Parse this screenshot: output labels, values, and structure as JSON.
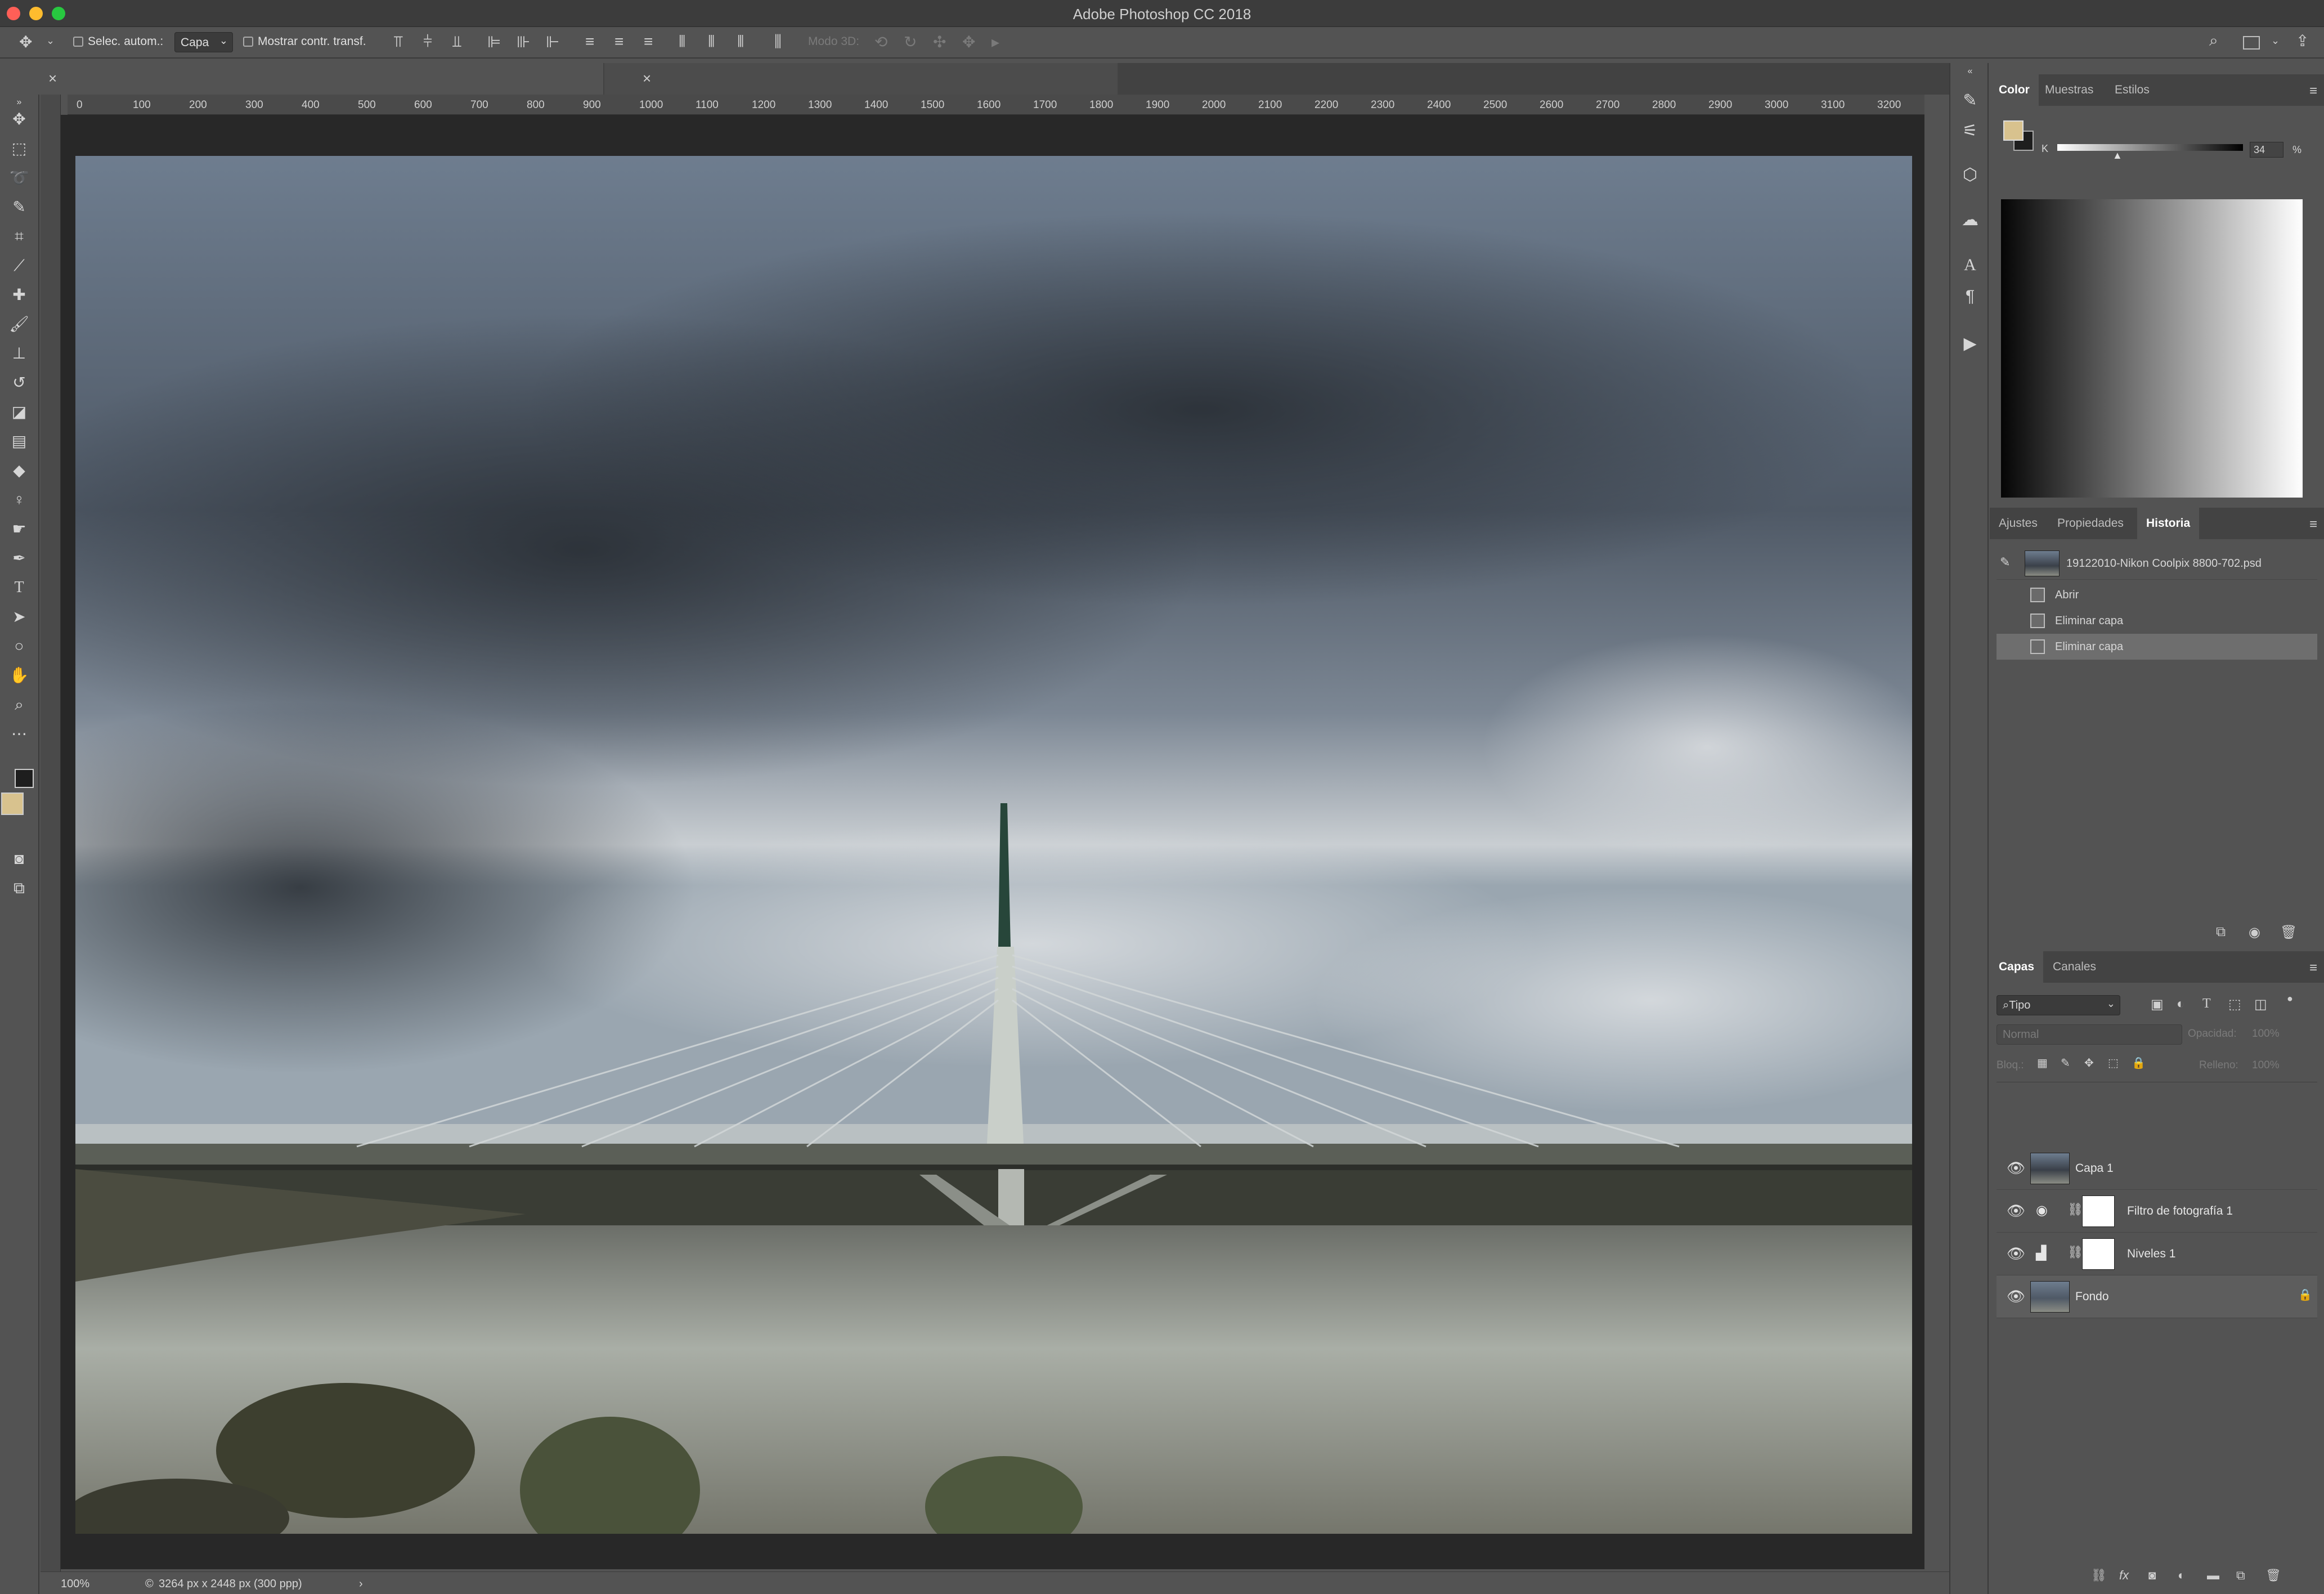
{
  "app": {
    "title": "Adobe Photoshop CC 2018"
  },
  "options": {
    "auto_select_label": "Selec. autom.:",
    "auto_select_value": "Capa",
    "show_transform_label": "Mostrar contr. transf.",
    "mode3d_label": "Modo 3D:"
  },
  "rulers": {
    "h_ticks": [
      "0",
      "100",
      "200",
      "300",
      "400",
      "500",
      "600",
      "700",
      "800",
      "900",
      "1000",
      "1100",
      "1200",
      "1300",
      "1400",
      "1500",
      "1600",
      "1700",
      "1800",
      "1900",
      "2000",
      "2100",
      "2200",
      "2300",
      "2400",
      "2500",
      "2600",
      "2700",
      "2800",
      "2900",
      "3000",
      "3100",
      "3200"
    ]
  },
  "status": {
    "zoom": "100%",
    "doc_info": "3264 px x 2448 px (300 ppp)"
  },
  "color_panel": {
    "tabs": [
      "Color",
      "Muestras",
      "Estilos"
    ],
    "active_tab": "Color",
    "slider_label": "K",
    "slider_value": "34",
    "slider_unit": "%",
    "foreground": "#d8c28e",
    "background": "#1e1e1e"
  },
  "history_panel": {
    "tabs": [
      "Ajustes",
      "Propiedades",
      "Historia"
    ],
    "active_tab": "Historia",
    "snapshot": "19122010-Nikon Coolpix 8800-702.psd",
    "steps": [
      "Abrir",
      "Eliminar capa",
      "Eliminar capa"
    ]
  },
  "layers_panel": {
    "tabs": [
      "Capas",
      "Canales"
    ],
    "active_tab": "Capas",
    "filter": "Tipo",
    "blend_mode": "Normal",
    "opacity_label": "Opacidad:",
    "opacity_value": "100%",
    "lock_label": "Bloq.:",
    "fill_label": "Relleno:",
    "fill_value": "100%",
    "layers": [
      {
        "name": "Capa 1",
        "type": "photo"
      },
      {
        "name": "Filtro de fotografía 1",
        "type": "adjustment"
      },
      {
        "name": "Niveles 1",
        "type": "adjustment"
      },
      {
        "name": "Fondo",
        "type": "photo"
      }
    ]
  },
  "photo": {
    "sky_top": "#6b7a8c",
    "cloud_dark": "#3a4049",
    "water": "#8a8c84"
  }
}
